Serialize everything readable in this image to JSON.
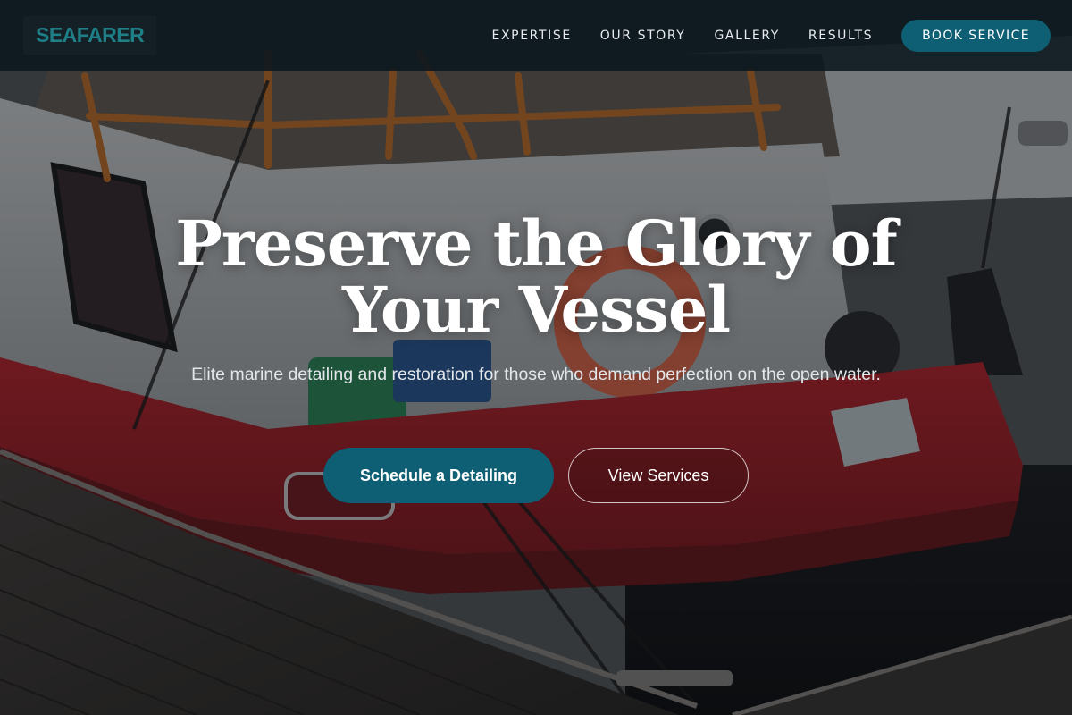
{
  "brand": {
    "name": "SEAFARER"
  },
  "nav": {
    "links": [
      {
        "label": "EXPERTISE"
      },
      {
        "label": "OUR STORY"
      },
      {
        "label": "GALLERY"
      },
      {
        "label": "RESULTS"
      }
    ],
    "cta_label": "BOOK SERVICE"
  },
  "hero": {
    "title": "Preserve the Glory of Your Vessel",
    "subtitle": "Elite marine detailing and restoration for those who demand perfection on the open water.",
    "primary_cta": "Schedule a Detailing",
    "secondary_cta": "View Services"
  },
  "colors": {
    "brand_accent": "#1f7f86",
    "button_primary": "#0e5f73",
    "header_bg": "#0a161e",
    "hull_red": "#a8202a"
  }
}
